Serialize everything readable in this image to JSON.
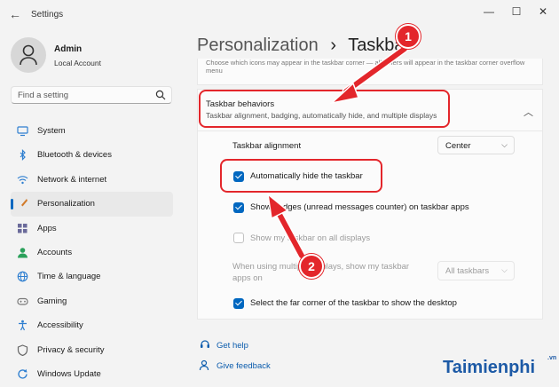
{
  "window": {
    "title": "Settings",
    "minimize": "—",
    "maximize": "☐",
    "close": "✕"
  },
  "profile": {
    "name": "Admin",
    "account": "Local Account"
  },
  "search": {
    "placeholder": "Find a setting"
  },
  "nav": [
    {
      "label": "System",
      "icon": "monitor-icon",
      "color": "#2f7fd0"
    },
    {
      "label": "Bluetooth & devices",
      "icon": "bluetooth-icon",
      "color": "#2f7fd0"
    },
    {
      "label": "Network & internet",
      "icon": "wifi-icon",
      "color": "#2f7fd0"
    },
    {
      "label": "Personalization",
      "icon": "brush-icon",
      "color": "#d17a2a"
    },
    {
      "label": "Apps",
      "icon": "apps-icon",
      "color": "#6a6a9a"
    },
    {
      "label": "Accounts",
      "icon": "person-icon",
      "color": "#2aa05a"
    },
    {
      "label": "Time & language",
      "icon": "globe-icon",
      "color": "#2f7fd0"
    },
    {
      "label": "Gaming",
      "icon": "gamepad-icon",
      "color": "#777777"
    },
    {
      "label": "Accessibility",
      "icon": "accessibility-icon",
      "color": "#2f7fd0"
    },
    {
      "label": "Privacy & security",
      "icon": "shield-icon",
      "color": "#666666"
    },
    {
      "label": "Windows Update",
      "icon": "update-icon",
      "color": "#2f7fd0"
    }
  ],
  "breadcrumb": {
    "parent": "Personalization",
    "separator": "›",
    "current": "Taskbar"
  },
  "overflow_text": "Choose which icons may appear in the taskbar corner — all others will appear in the taskbar corner overflow menu",
  "behaviors": {
    "title": "Taskbar behaviors",
    "subtitle": "Taskbar alignment, badging, automatically hide, and multiple displays",
    "alignment_label": "Taskbar alignment",
    "alignment_value": "Center",
    "auto_hide": "Automatically hide the taskbar",
    "badges": "Show badges (unread messages counter) on taskbar apps",
    "all_displays": "Show my taskbar on all displays",
    "multi_line1": "When using multiple displays, show my taskbar",
    "multi_line2": "apps on",
    "multi_value": "All taskbars",
    "far_corner": "Select the far corner of the taskbar to show the desktop"
  },
  "links": {
    "help": "Get help",
    "feedback": "Give feedback"
  },
  "annotations": {
    "one": "1",
    "two": "2",
    "color": "#e3262b"
  },
  "watermark": {
    "brand": "Taimienphi",
    "suffix": ".vn"
  }
}
